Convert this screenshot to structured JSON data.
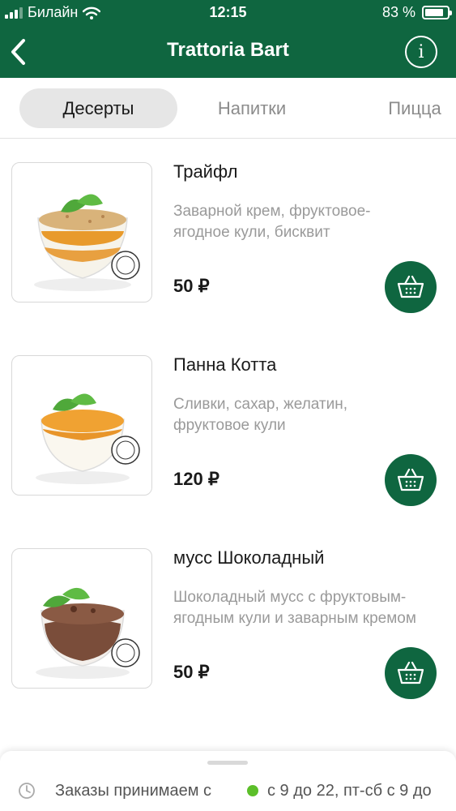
{
  "status_bar": {
    "carrier": "Билайн",
    "time": "12:15",
    "battery_text": "83 %",
    "battery_level": 0.83,
    "icons": [
      "signal-icon",
      "wifi-icon",
      "battery-icon"
    ]
  },
  "nav": {
    "title": "Trattoria Bart",
    "back_icon": "chevron-left-icon",
    "info_icon": "info-icon",
    "info_glyph": "i"
  },
  "tabs": [
    {
      "label": "Десерты",
      "active": true
    },
    {
      "label": "Напитки",
      "active": false
    },
    {
      "label": "Пицца",
      "active": false
    }
  ],
  "products": [
    {
      "name": "Трайфл",
      "description": "Заварной крем, фруктовое-ягодное кули, бисквит",
      "price": "50 ₽",
      "cart_icon": "basket-icon"
    },
    {
      "name": "Панна Котта",
      "description": "Сливки, сахар, желатин, фруктовое кули",
      "price": "120 ₽",
      "cart_icon": "basket-icon"
    },
    {
      "name": "мусс Шоколадный",
      "description": "Шоколадный мусс с фруктовым-ягодным кули и заварным кремом",
      "price": "50 ₽",
      "cart_icon": "basket-icon"
    }
  ],
  "footer": {
    "label": "Заказы принимаем с",
    "hours": "с 9 до 22, пт-сб с 9 до",
    "status_color": "#5cbf2a"
  },
  "colors": {
    "brand": "#0f6640",
    "tab_active_bg": "#e6e6e6",
    "muted_text": "#9a9a9a"
  }
}
